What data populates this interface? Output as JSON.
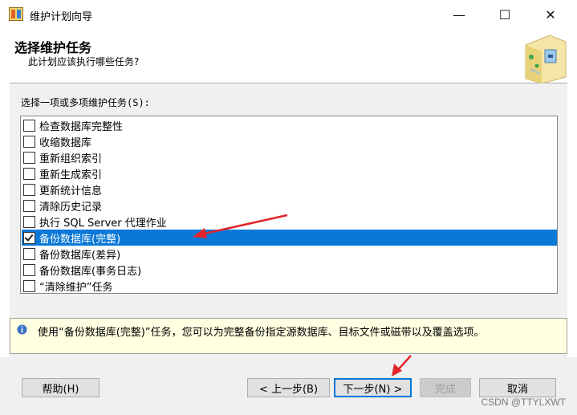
{
  "window": {
    "title": "维护计划向导",
    "minimize_glyph": "—",
    "maximize_glyph": "☐",
    "close_glyph": "✕"
  },
  "header": {
    "title": "选择维护任务",
    "subtitle": "此计划应该执行哪些任务?"
  },
  "list_label": "选择一项或多项维护任务(S):",
  "tasks": [
    {
      "label": "检查数据库完整性",
      "checked": false,
      "selected": false
    },
    {
      "label": "收缩数据库",
      "checked": false,
      "selected": false
    },
    {
      "label": "重新组织索引",
      "checked": false,
      "selected": false
    },
    {
      "label": "重新生成索引",
      "checked": false,
      "selected": false
    },
    {
      "label": "更新统计信息",
      "checked": false,
      "selected": false
    },
    {
      "label": "清除历史记录",
      "checked": false,
      "selected": false
    },
    {
      "label": "执行 SQL Server 代理作业",
      "checked": false,
      "selected": false
    },
    {
      "label": "备份数据库(完整)",
      "checked": true,
      "selected": true
    },
    {
      "label": "备份数据库(差异)",
      "checked": false,
      "selected": false
    },
    {
      "label": "备份数据库(事务日志)",
      "checked": false,
      "selected": false
    },
    {
      "label": "“清除维护”任务",
      "checked": false,
      "selected": false
    }
  ],
  "description": "使用“备份数据库(完整)”任务，您可以为完整备份指定源数据库、目标文件或磁带以及覆盖选项。",
  "buttons": {
    "help": "帮助(H)",
    "back": "< 上一步(B)",
    "next": "下一步(N) >",
    "finish": "完成",
    "cancel": "取消"
  },
  "watermark": "CSDN @TTYLXWT",
  "colors": {
    "selection": "#0a78d7",
    "annotation_arrow": "#e3242b",
    "description_bg": "#ffffe1"
  }
}
